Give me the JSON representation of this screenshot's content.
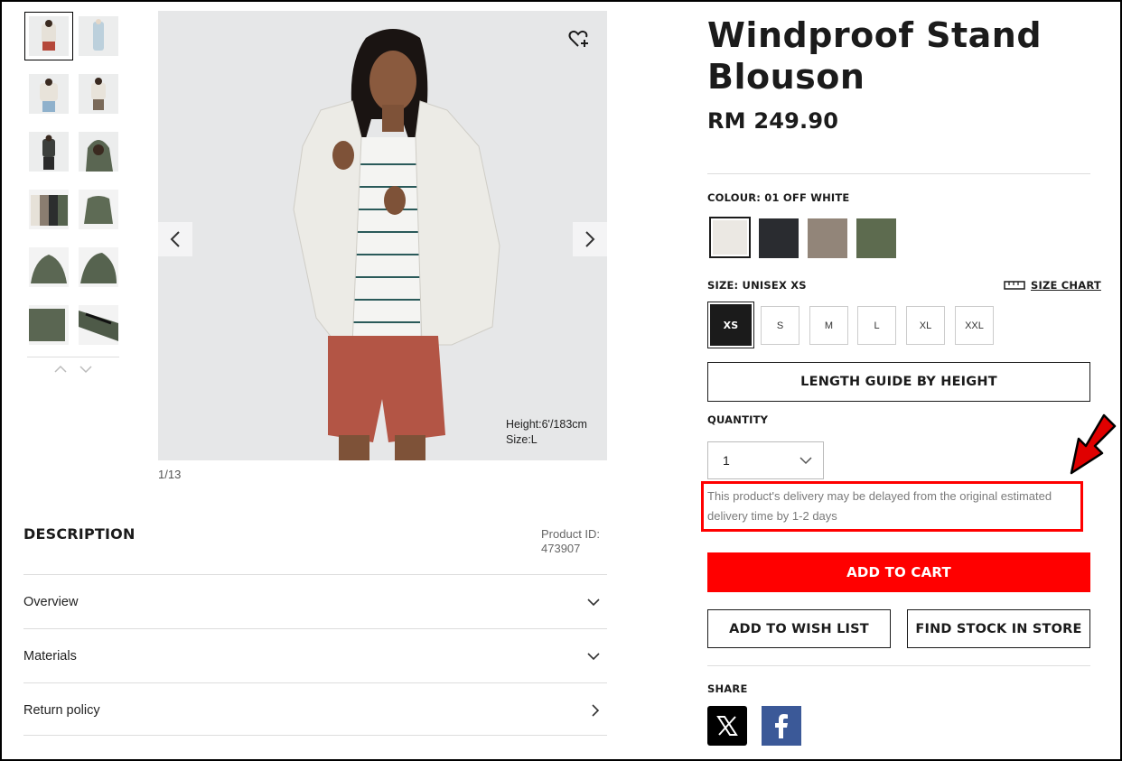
{
  "product": {
    "title": "Windproof Stand Blouson",
    "price": "RM 249.90",
    "product_id_label": "Product ID:",
    "product_id": "473907"
  },
  "gallery": {
    "counter": "1/13",
    "model_height": "Height:6'/183cm",
    "model_size": "Size:L",
    "thumbnail_colors": [
      "#e9e6e1",
      "#bcd0dc",
      "#dfe3e8",
      "#e6e2dc",
      "#3c3f3c",
      "#5a6652",
      "#6b7466",
      "#5e6b55",
      "#5b6753",
      "#56634f",
      "#5a6652",
      "#4e5a48"
    ]
  },
  "colour": {
    "label": "COLOUR: 01 OFF WHITE",
    "swatches": [
      {
        "name": "01 OFF WHITE",
        "color": "#ebe8e3"
      },
      {
        "name": "Black",
        "color": "#2a2c30"
      },
      {
        "name": "Beige",
        "color": "#928579"
      },
      {
        "name": "Olive",
        "color": "#5d6b4f"
      }
    ]
  },
  "size": {
    "label": "SIZE: UNISEX XS",
    "chart_label": "SIZE CHART",
    "options": [
      "XS",
      "S",
      "M",
      "L",
      "XL",
      "XXL"
    ]
  },
  "length_guide": "LENGTH GUIDE BY HEIGHT",
  "quantity": {
    "label": "QUANTITY",
    "value": "1"
  },
  "delivery_notice": "This product's delivery may be delayed from the original estimated delivery time by 1-2 days",
  "buttons": {
    "add_to_cart": "ADD TO CART",
    "add_to_wish_list": "ADD TO WISH LIST",
    "find_stock": "FIND STOCK IN STORE"
  },
  "share": {
    "label": "SHARE",
    "x_icon": "x-icon",
    "facebook_icon": "facebook-icon"
  },
  "description": {
    "title": "DESCRIPTION",
    "sections": [
      "Overview",
      "Materials",
      "Return policy"
    ]
  },
  "colors": {
    "accent_red": "#ff0000",
    "facebook_blue": "#3b5998"
  }
}
